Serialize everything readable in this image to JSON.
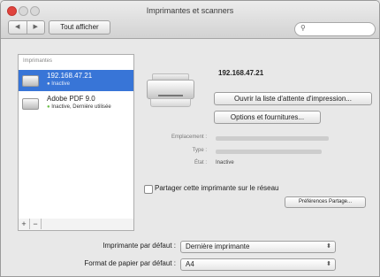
{
  "window": {
    "title": "Imprimantes et scanners"
  },
  "toolbar": {
    "back_glyph": "◀",
    "forward_glyph": "▶",
    "show_all": "Tout afficher",
    "search_placeholder": ""
  },
  "sidebar": {
    "header": "Imprimantes",
    "printers": [
      {
        "name": "192.168.47.21",
        "status": "Inactive",
        "selected": true
      },
      {
        "name": "Adobe PDF 9.0",
        "status": "Inactive, Dernière utilisée",
        "selected": false
      }
    ],
    "add_glyph": "+",
    "remove_glyph": "−"
  },
  "detail": {
    "printer_name": "192.168.47.21",
    "open_queue_button": "Ouvrir la liste d'attente d'impression...",
    "options_button": "Options et fournitures...",
    "location_label": "Emplacement :",
    "type_label": "Type :",
    "state_label": "État :",
    "state_value": "Inactive",
    "share_label": "Partager cette imprimante sur le réseau",
    "sharing_prefs_button": "Préférences Partage..."
  },
  "defaults": {
    "default_printer_label": "Imprimante par défaut :",
    "default_printer_value": "Dernière imprimante",
    "paper_size_label": "Format de papier par défaut :",
    "paper_size_value": "A4"
  },
  "colors": {
    "selection": "#3875d7",
    "close_button": "#e0443e",
    "status_dot_idle": "#6cbf4a"
  }
}
